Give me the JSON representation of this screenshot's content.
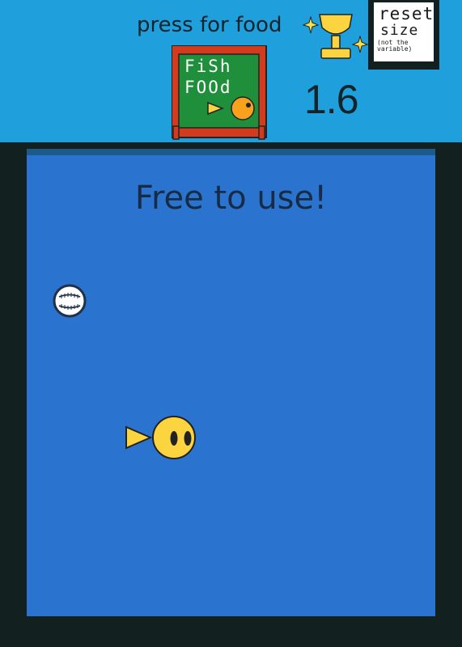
{
  "hud": {
    "press_label": "press for food",
    "counter": "1.6"
  },
  "fish_food_sign": {
    "line1": "FiSh",
    "line2": "FOOd"
  },
  "reset_button": {
    "line1": "reset",
    "line2": "size",
    "line3": "(not the variable)"
  },
  "tank": {
    "banner": "Free to use!"
  },
  "colors": {
    "sky": "#1f9fdc",
    "water": "#2a74d0",
    "tank_frame": "#12201f",
    "fish_yellow": "#fcd440",
    "sign_green": "#1f8f3b",
    "sign_frame": "#d33b1f"
  },
  "icons": [
    "trophy-icon",
    "sparkle-icon",
    "baseball-icon",
    "fish-icon"
  ]
}
